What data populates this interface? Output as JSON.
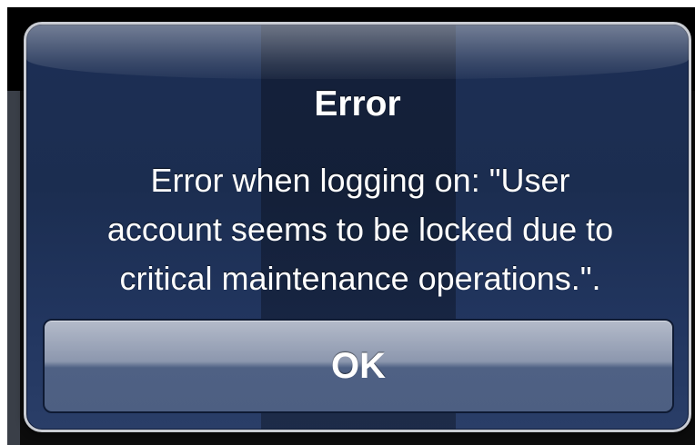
{
  "alert": {
    "title": "Error",
    "message_lines": [
      "Error when logging on: \"User",
      "account seems to be locked due to",
      "critical maintenance operations.\"."
    ],
    "ok_label": "OK"
  },
  "colors": {
    "dialog_background": "#1d2f55",
    "dialog_border": "#c9ccd3",
    "button_top": "#b4bbca",
    "button_bottom": "#4d5f82",
    "text": "#ffffff"
  }
}
